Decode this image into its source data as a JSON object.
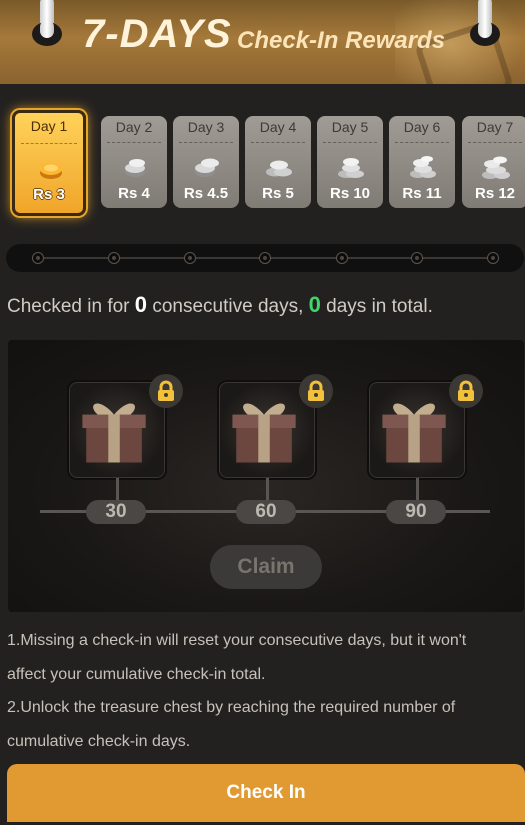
{
  "header": {
    "title_main": "7-DAYS",
    "title_sub": "Check-In Rewards"
  },
  "days": [
    {
      "label": "Day 1",
      "amount": "Rs 3",
      "active": true
    },
    {
      "label": "Day 2",
      "amount": "Rs 4"
    },
    {
      "label": "Day 3",
      "amount": "Rs 4.5"
    },
    {
      "label": "Day 4",
      "amount": "Rs 5"
    },
    {
      "label": "Day 5",
      "amount": "Rs 10"
    },
    {
      "label": "Day 6",
      "amount": "Rs 11"
    },
    {
      "label": "Day 7",
      "amount": "Rs 12"
    }
  ],
  "status": {
    "prefix": "Checked in for",
    "consecutive": "0",
    "middle": "consecutive days,",
    "total": "0",
    "suffix": "days in total."
  },
  "rewards": {
    "milestones": [
      "30",
      "60",
      "90"
    ],
    "claim_label": "Claim"
  },
  "rules": [
    "1.Missing a check-in will reset your consecutive days, but it won't",
    "affect your cumulative check-in total.",
    "2.Unlock the treasure chest by reaching the required number of",
    "cumulative check-in days."
  ],
  "checkin_label": "Check In",
  "colors": {
    "accent": "#e09a31",
    "highlight": "#ffd25a",
    "green": "#3fd66a"
  }
}
